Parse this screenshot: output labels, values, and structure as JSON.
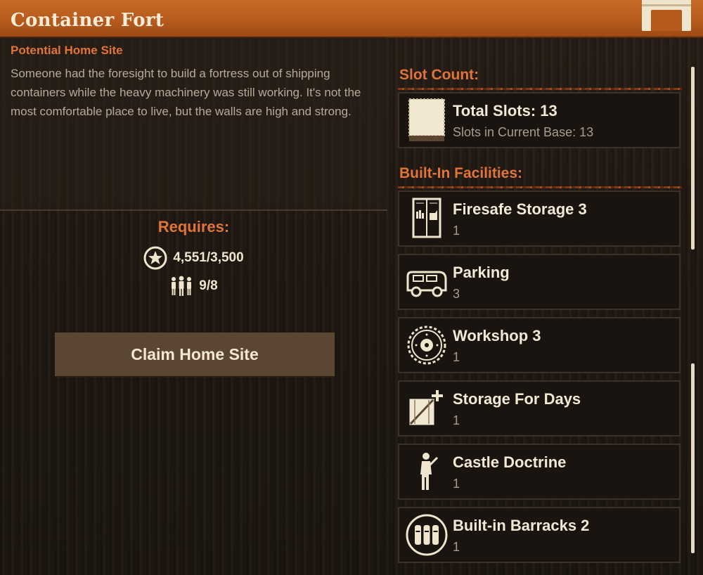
{
  "header": {
    "title": "Container Fort"
  },
  "site": {
    "subtitle": "Potential Home Site",
    "description": "Someone had the foresight to build a fortress out of shipping containers while the heavy machinery was still working. It's not the most comfortable place to live, but the walls are high and strong."
  },
  "requires": {
    "label": "Requires:",
    "influence": "4,551/3,500",
    "influence_icon": "star-icon",
    "survivors": "9/8",
    "survivors_icon": "people-icon"
  },
  "claim_button": "Claim Home Site",
  "slots": {
    "heading": "Slot Count:",
    "total": "Total Slots: 13",
    "current": "Slots in Current Base: 13",
    "icon": "slot-icon"
  },
  "facilities": {
    "heading": "Built-In Facilities:",
    "items": [
      {
        "name": "Firesafe Storage 3",
        "value": "1",
        "icon": "locker-icon"
      },
      {
        "name": "Parking",
        "value": "3",
        "icon": "vehicle-icon"
      },
      {
        "name": "Workshop 3",
        "value": "1",
        "icon": "sawblade-icon"
      },
      {
        "name": "Storage For Days",
        "value": "1",
        "icon": "crate-icon"
      },
      {
        "name": "Castle Doctrine",
        "value": "1",
        "icon": "rifleman-icon"
      },
      {
        "name": "Built-in Barracks 2",
        "value": "1",
        "icon": "barracks-icon"
      }
    ]
  },
  "colors": {
    "accent": "#e0743a",
    "header": "#b55a1c",
    "text_light": "#f2e8d4",
    "button": "#5b4634"
  }
}
